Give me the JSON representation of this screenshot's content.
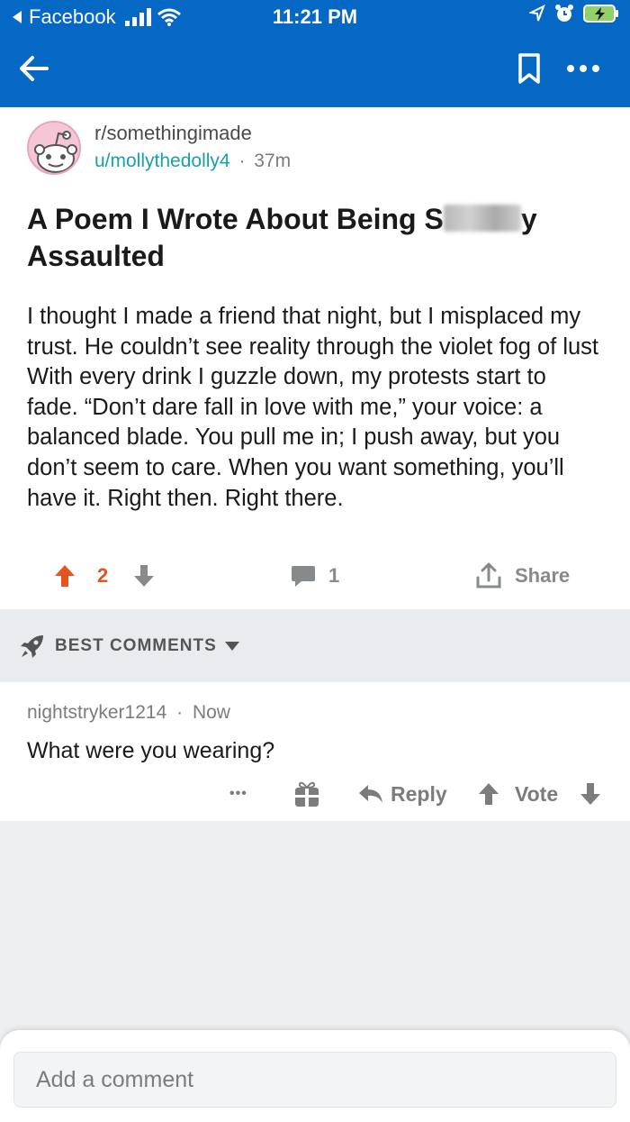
{
  "status_bar": {
    "back_app": "Facebook",
    "time": "11:21 PM"
  },
  "icons": {
    "back": "back-arrow-icon",
    "bookmark": "bookmark-icon",
    "more": "more-options-icon",
    "upvote": "upvote-arrow-icon",
    "downvote": "downvote-arrow-icon",
    "comment": "comment-bubble-icon",
    "share": "share-icon",
    "rocket": "rocket-icon",
    "award": "gift-award-icon",
    "reply": "reply-icon"
  },
  "colors": {
    "header": "#0468c4",
    "upvoted": "#e5531e",
    "username": "#17a2a8"
  },
  "post": {
    "subreddit": "r/somethingimade",
    "author": "u/mollythedolly4",
    "separator": "·",
    "age": "37m",
    "title_part1": "A Poem I Wrote About Being S",
    "title_part2": "y",
    "title_part3": "Assaulted",
    "body": "I thought I made a friend that night, but I misplaced my trust. He couldn’t see reality through the violet fog of lust With every drink I guzzle down, my protests start to fade. “Don’t dare fall in love with me,” your voice: a balanced blade. You pull me in; I push away, but you don’t seem to care. When you want something, you’ll have it. Right then. Right there.",
    "score": "2",
    "comment_count": "1",
    "share_label": "Share"
  },
  "comments_sort": {
    "label": "BEST COMMENTS"
  },
  "comment": {
    "author": "nightstryker1214",
    "separator": "·",
    "age": "Now",
    "text": "What were you wearing?",
    "more_label": "•••",
    "reply_label": "Reply",
    "vote_label": "Vote"
  },
  "composer": {
    "placeholder": "Add a comment"
  }
}
